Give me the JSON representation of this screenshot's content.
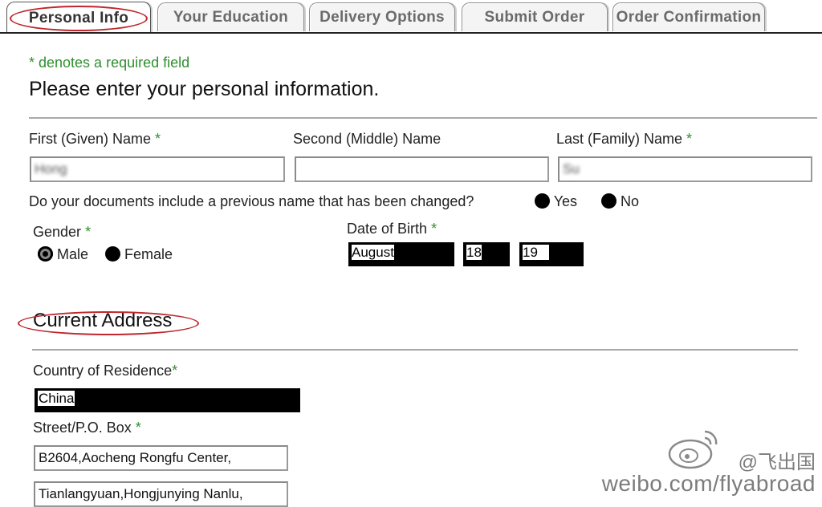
{
  "tabs": [
    {
      "label": "Personal Info",
      "active": true
    },
    {
      "label": "Your Education",
      "active": false
    },
    {
      "label": "Delivery Options",
      "active": false
    },
    {
      "label": "Submit Order",
      "active": false
    },
    {
      "label": "Order Confirmation",
      "active": false
    }
  ],
  "form": {
    "required_note": "* denotes a required field",
    "heading": "Please enter your personal information.",
    "first_name_label": "First (Given) Name",
    "middle_name_label": "Second (Middle) Name",
    "last_name_label": "Last (Family) Name",
    "required_mark": "*",
    "first_name_value": "Hong",
    "middle_name_value": "",
    "last_name_value": "Su",
    "previous_name_question": "Do your documents include a previous name that has been changed?",
    "yes_label": "Yes",
    "no_label": "No",
    "gender_label": "Gender",
    "male_label": "Male",
    "female_label": "Female",
    "gender_selected": "Male",
    "dob_label": "Date of Birth",
    "dob_month": "August",
    "dob_day": "18",
    "dob_year": "19"
  },
  "address": {
    "section_title": "Current Address",
    "country_label": "Country of Residence",
    "country_value": "China",
    "street_label": "Street/P.O. Box",
    "street_line1": "B2604,Aocheng Rongfu Center,",
    "street_line2": "Tianlangyuan,Hongjunying Nanlu,"
  },
  "watermark": {
    "handle": "@飞出国",
    "url": "weibo.com/flyabroad"
  },
  "colors": {
    "required": "#2f8f2f",
    "highlight_ellipse": "#c0262d"
  }
}
